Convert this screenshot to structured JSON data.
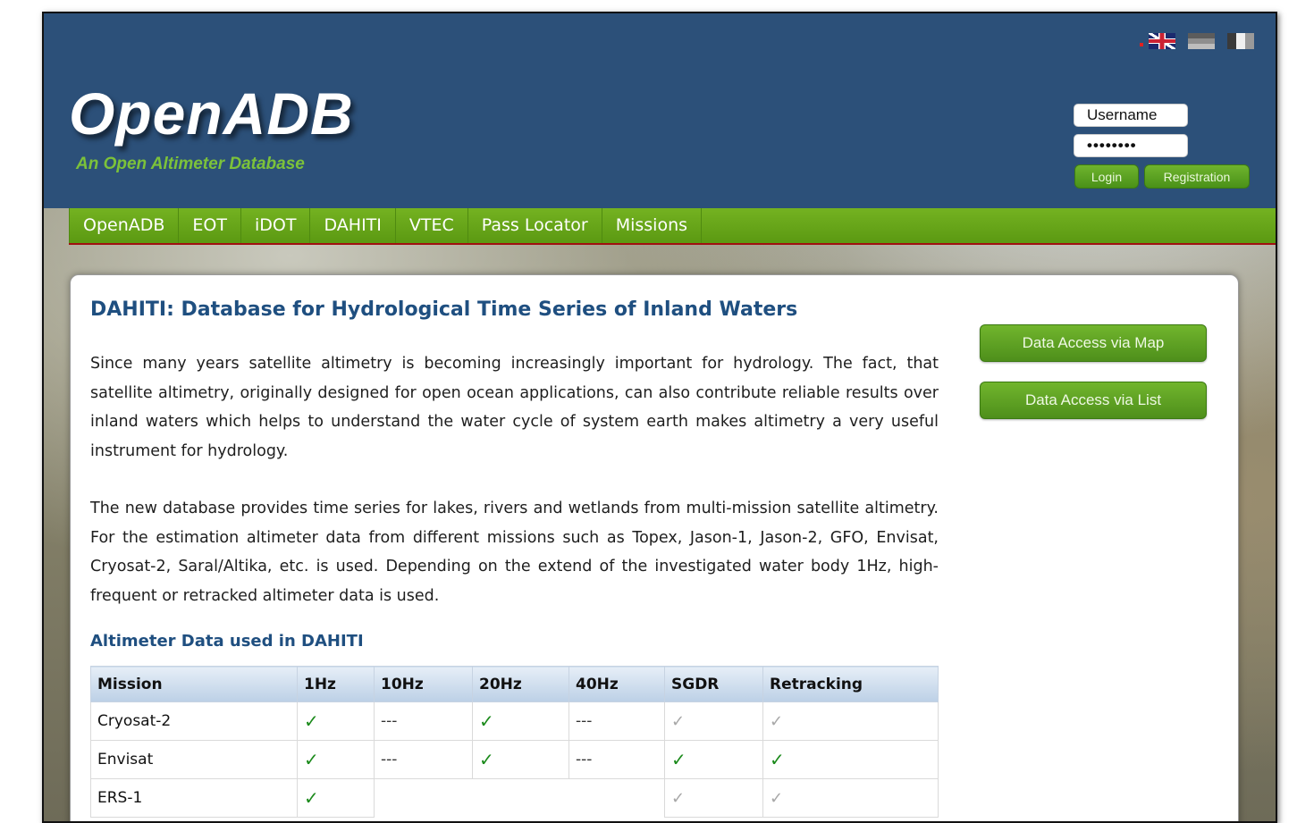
{
  "header": {
    "logo": "OpenADB",
    "tagline": "An Open Altimeter Database"
  },
  "login": {
    "username_value": "Username",
    "password_value": "••••••••",
    "login_label": "Login",
    "register_label": "Registration"
  },
  "nav": {
    "items": [
      "OpenADB",
      "EOT",
      "iDOT",
      "DAHITI",
      "VTEC",
      "Pass Locator",
      "Missions"
    ]
  },
  "content": {
    "title": "DAHITI: Database for Hydrological Time Series of Inland Waters",
    "para1": "Since many years satellite altimetry is becoming increasingly important for hydrology. The fact, that satellite altimetry, originally designed for open ocean applications, can also contribute reliable results over inland waters which helps to understand the water cycle of system earth makes altimetry a very useful instrument for hydrology.",
    "para2": "The new database provides time series for lakes, rivers and wetlands from multi-mission satellite altimetry. For the estimation altimeter data from different missions such as Topex, Jason-1, Jason-2, GFO, Envisat, Cryosat-2, Saral/Altika, etc. is used. Depending on the extend of the investigated water body 1Hz, high-frequent or retracked altimeter data is used.",
    "subtitle": "Altimeter Data used in DAHITI"
  },
  "side_buttons": {
    "map": "Data Access via Map",
    "list": "Data Access via List"
  },
  "table": {
    "headers": [
      "Mission",
      "1Hz",
      "10Hz",
      "20Hz",
      "40Hz",
      "SGDR",
      "Retracking"
    ],
    "rows": [
      {
        "mission": "Cryosat-2",
        "hz1": "✓",
        "hz10": "---",
        "hz20": "✓",
        "hz40": "---",
        "sgdr": "✓",
        "retracking": "✓"
      },
      {
        "mission": "Envisat",
        "hz1": "✓",
        "hz10": "---",
        "hz20": "✓",
        "hz40": "---",
        "sgdr": "✓",
        "retracking": "✓"
      },
      {
        "mission": "ERS-1",
        "hz1": "✓",
        "hz10": "",
        "hz20": "",
        "hz40": "",
        "sgdr": "✓",
        "retracking": "✓"
      }
    ]
  },
  "colors": {
    "header_bg": "#2c5079",
    "nav_green": "#66a51a",
    "title_blue": "#1f4f80",
    "check_green": "#1b8a1b",
    "check_grey": "#a7a7a7"
  }
}
